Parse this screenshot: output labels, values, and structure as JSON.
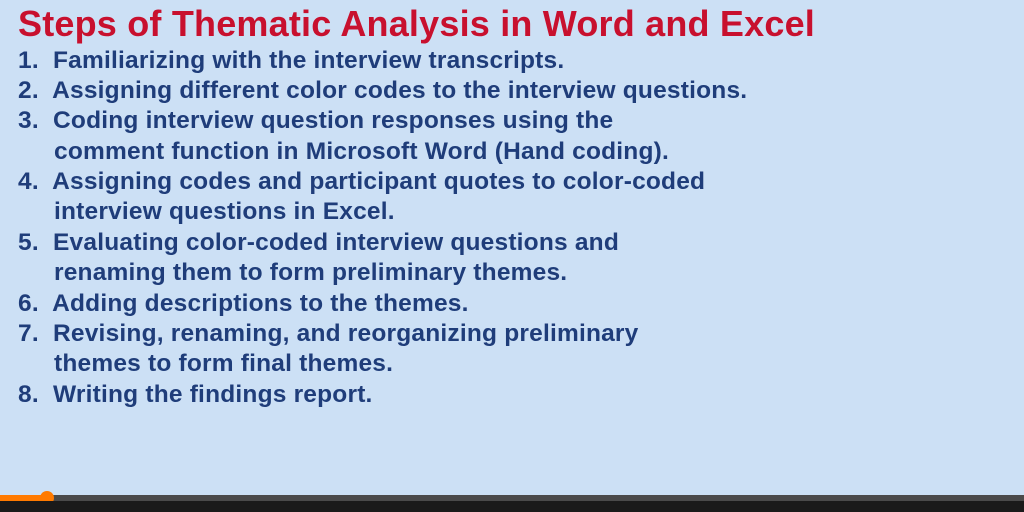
{
  "title": "Steps of Thematic Analysis in Word and Excel",
  "steps": [
    {
      "num": "1.",
      "line1": "Familiarizing with the interview transcripts."
    },
    {
      "num": "2.",
      "line1": "Assigning different color codes to the interview questions."
    },
    {
      "num": "3.",
      "line1": "Coding interview question responses using the",
      "line2": "comment function in Microsoft Word (Hand coding)."
    },
    {
      "num": "4.",
      "line1": "Assigning codes and participant quotes to color-coded",
      "line2": "interview questions in Excel."
    },
    {
      "num": "5.",
      "line1": "Evaluating color-coded interview questions and",
      "line2": "renaming them to form preliminary themes."
    },
    {
      "num": "6.",
      "line1": "Adding descriptions to the themes."
    },
    {
      "num": "7.",
      "line1": "Revising, renaming, and reorganizing preliminary",
      "line2": " themes to form final themes."
    },
    {
      "num": "8.",
      "line1": "Writing the findings report."
    }
  ],
  "progress_pct": 4.6
}
